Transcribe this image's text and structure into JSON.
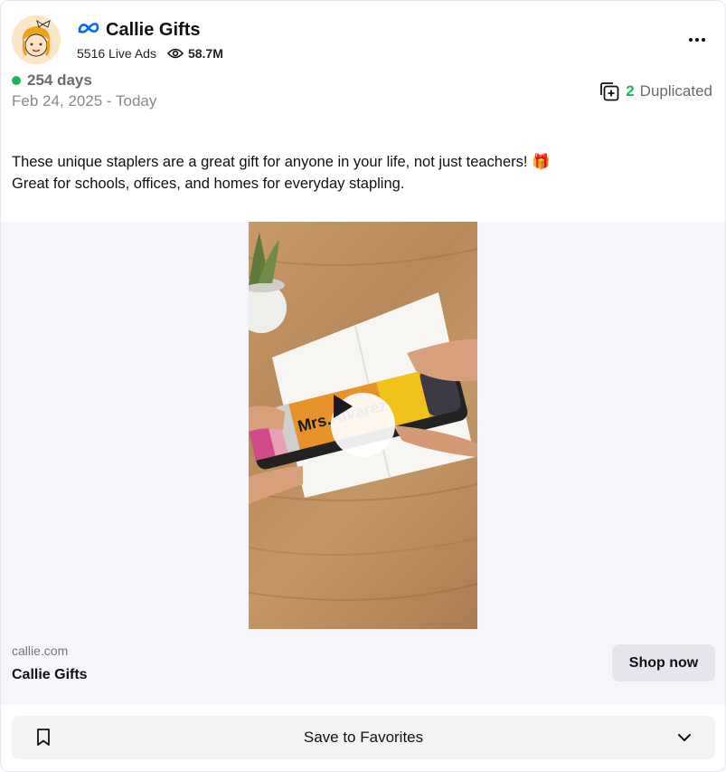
{
  "advertiser": {
    "name": "Callie Gifts",
    "live_ads": "5516 Live Ads",
    "views": "58.7M",
    "platform_icon": "meta-icon"
  },
  "status": {
    "days_active": "254 days",
    "date_range": "Feb 24, 2025 - Today",
    "duplicated_count": "2",
    "duplicated_label": "Duplicated",
    "active_color": "#22b35e"
  },
  "ad": {
    "caption_line1": "These unique staplers are a great gift for anyone in your life, not just teachers! 🎁",
    "caption_line2": "Great for schools, offices, and homes for everyday stapling.",
    "stapler_text": "Mrs.Alvarez",
    "domain": "callie.com",
    "link_title": "Callie Gifts",
    "cta_label": "Shop now"
  },
  "footer": {
    "save_label": "Save to Favorites"
  }
}
